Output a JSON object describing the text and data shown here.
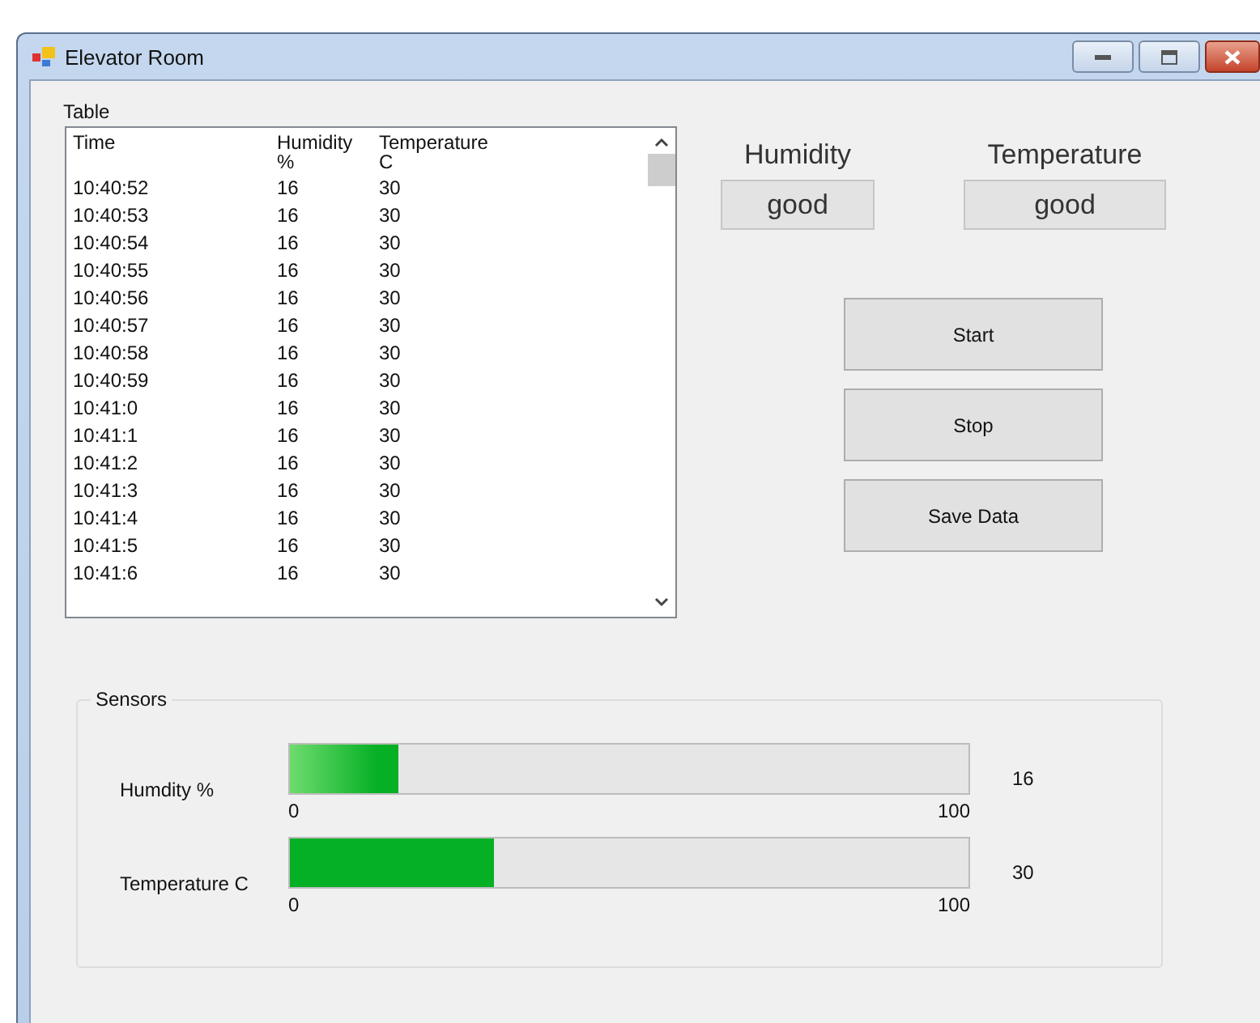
{
  "window": {
    "title": "Elevator Room"
  },
  "table": {
    "label": "Table",
    "columns": [
      "Time",
      "Humidity\n%",
      "Temperature\nC"
    ],
    "rows": [
      [
        "10:40:52",
        "16",
        "30"
      ],
      [
        "10:40:53",
        "16",
        "30"
      ],
      [
        "10:40:54",
        "16",
        "30"
      ],
      [
        "10:40:55",
        "16",
        "30"
      ],
      [
        "10:40:56",
        "16",
        "30"
      ],
      [
        "10:40:57",
        "16",
        "30"
      ],
      [
        "10:40:58",
        "16",
        "30"
      ],
      [
        "10:40:59",
        "16",
        "30"
      ],
      [
        "10:41:0",
        "16",
        "30"
      ],
      [
        "10:41:1",
        "16",
        "30"
      ],
      [
        "10:41:2",
        "16",
        "30"
      ],
      [
        "10:41:3",
        "16",
        "30"
      ],
      [
        "10:41:4",
        "16",
        "30"
      ],
      [
        "10:41:5",
        "16",
        "30"
      ],
      [
        "10:41:6",
        "16",
        "30"
      ]
    ]
  },
  "status": [
    {
      "label": "Humidity",
      "value": "good"
    },
    {
      "label": "Temperature",
      "value": "good"
    }
  ],
  "buttons": [
    "Start",
    "Stop",
    "Save Data"
  ],
  "sensors": {
    "title": "Sensors",
    "meters": [
      {
        "label": "Humdity %",
        "level": 0.16,
        "min": "0",
        "max": "100",
        "reading": "16"
      },
      {
        "label": "Temperature C",
        "level": 0.3,
        "min": "0",
        "max": "100",
        "reading": "30"
      }
    ]
  }
}
